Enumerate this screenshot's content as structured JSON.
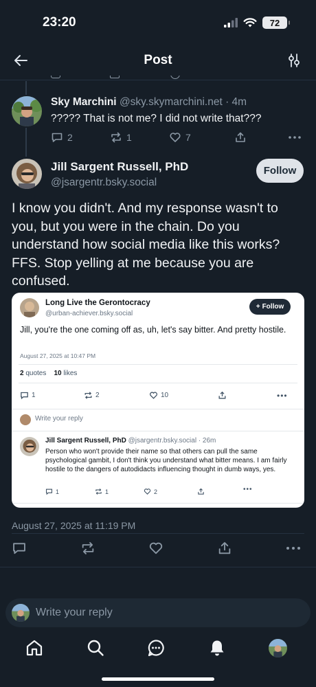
{
  "status_bar": {
    "time": "23:20",
    "battery": "72"
  },
  "header": {
    "title": "Post"
  },
  "reply_post": {
    "name": "Sky Marchini",
    "handle": "@sky.skymarchini.net",
    "time": "· 4m",
    "text": "????? That is not me? I did not write that???",
    "replies": "2",
    "reposts": "1",
    "likes": "7"
  },
  "main_post": {
    "name": "Jill Sargent Russell, PhD",
    "handle": "@jsargentr.bsky.social",
    "follow_label": "Follow",
    "text": "I know you didn't. And my response wasn't to you, but you were in the chain. Do you understand how social media like this works? FFS. Stop yelling at me because you are confused.",
    "timestamp": "August 27, 2025 at 11:19 PM"
  },
  "embedded": {
    "name": "Long Live the Gerontocracy",
    "handle": "@urban-achiever.bsky.social",
    "follow_label": "Follow",
    "text": "Jill, you're the one coming off as, uh, let's say bitter. And pretty hostile.",
    "timestamp": "August 27, 2025 at 10:47 PM",
    "quotes_count": "2",
    "quotes_label": "quotes",
    "likes_count": "10",
    "likes_label": "likes",
    "replies": "1",
    "reposts": "2",
    "like_count": "10",
    "reply_placeholder": "Write your reply",
    "reply": {
      "name": "Jill Sargent Russell, PhD",
      "handle": "@jsargentr.bsky.social",
      "time": "· 26m",
      "text": "Person who won't provide their name so that others can pull the same psychological gambit, I don't think you understand what bitter means. I am fairly hostile to the dangers of autodidacts influencing thought in dumb ways, yes.",
      "replies": "1",
      "reposts": "1",
      "likes": "2"
    }
  },
  "composer": {
    "placeholder": "Write your reply"
  },
  "icons": [
    "back-arrow-icon",
    "settings-sliders-icon",
    "reply-icon",
    "repost-icon",
    "like-icon",
    "share-icon",
    "more-icon",
    "home-icon",
    "search-icon",
    "chat-icon",
    "bell-icon"
  ],
  "colors": {
    "background": "#161e27",
    "muted": "#8b98a5",
    "accent": "#1083fe"
  }
}
